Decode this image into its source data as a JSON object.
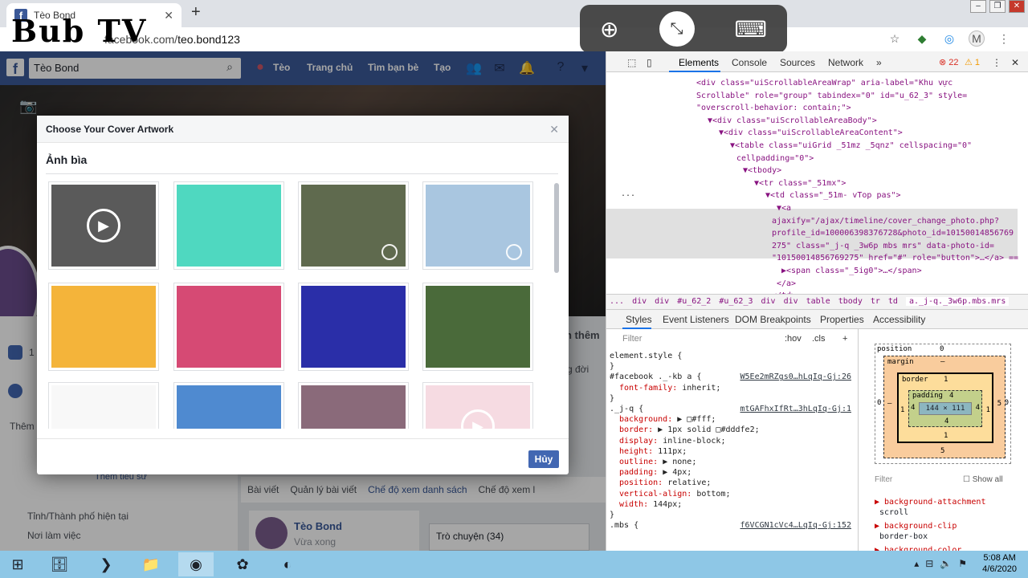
{
  "browser": {
    "tab_title": "Tèo Bond",
    "url_prefix": "facebook.com/",
    "url_path": "teo.bond123",
    "watermark": "Bub TV",
    "profile_initial": "M"
  },
  "remote_toolbar": {
    "zoom_icon": "zoom-in-icon",
    "connection_icon": "remote-connection-icon",
    "keyboard_icon": "keyboard-icon"
  },
  "facebook": {
    "logo": "f",
    "search_value": "Tèo Bond",
    "nav": {
      "profile": "Tèo",
      "home": "Trang chủ",
      "find_friends": "Tìm bạn bè",
      "create": "Tạo"
    },
    "behind": {
      "add_friend_partial": "n thêm",
      "link_partial": "g đời",
      "left_add": "Thêm",
      "left_add_partial": "Thêm tiểu sử",
      "city": "Tỉnh/Thành phố hiện tại",
      "workplace": "Nơi làm việc",
      "left_count": "1",
      "notif_badge": "1"
    },
    "timeline_tabs": {
      "posts": "Bài viết",
      "manage": "Quản lý bài viết",
      "list_view": "Chế độ xem danh sách",
      "grid_view": "Chế độ xem l"
    },
    "post": {
      "author": "Tèo Bond",
      "time": "Vừa xong"
    },
    "chat": "Trò chuyện (34)"
  },
  "dialog": {
    "title": "Choose Your Cover Artwork",
    "section": "Ảnh bìa",
    "cancel": "Hủy",
    "close_icon": "close-icon",
    "thumbnails": [
      {
        "name": "thumb-rocks-video",
        "bg": "#5a5a5a",
        "has_play": true,
        "has_target": false
      },
      {
        "name": "thumb-teal-pattern",
        "bg": "#4fd8c0",
        "has_play": false,
        "has_target": false
      },
      {
        "name": "thumb-waterfall-cliff",
        "bg": "#5f6a4e",
        "has_play": false,
        "has_target": true
      },
      {
        "name": "thumb-sky-clouds",
        "bg": "#a9c6e0",
        "has_play": false,
        "has_target": true
      },
      {
        "name": "thumb-yellow-pattern",
        "bg": "#f4b43a",
        "has_play": false,
        "has_target": false
      },
      {
        "name": "thumb-paint-strokes",
        "bg": "#d64a74",
        "has_play": false,
        "has_target": false
      },
      {
        "name": "thumb-blue-kaleidoscope",
        "bg": "#2a2ea8",
        "has_play": false,
        "has_target": false
      },
      {
        "name": "thumb-forest-waterfall",
        "bg": "#4a6a3a",
        "has_play": false,
        "has_target": false
      },
      {
        "name": "thumb-lines",
        "bg": "#f8f8f8",
        "has_play": false,
        "has_target": false
      },
      {
        "name": "thumb-blue-sky",
        "bg": "#4f8ad0",
        "has_play": false,
        "has_target": false
      },
      {
        "name": "thumb-sunset-mountain",
        "bg": "#8a6a7a",
        "has_play": false,
        "has_target": false
      },
      {
        "name": "thumb-hearts-video",
        "bg": "#f6dbe2",
        "has_play": true,
        "has_target": false
      }
    ]
  },
  "devtools": {
    "tabs": [
      "Elements",
      "Console",
      "Sources",
      "Network",
      "»"
    ],
    "errors": "22",
    "warnings": "1",
    "dom_lines": [
      {
        "text": "<div class=\"uiScrollableAreaWrap\" aria-label=\"Khu vực",
        "indent": 112
      },
      {
        "text": "Scrollable\" role=\"group\" tabindex=\"0\" id=\"u_62_3\" style=",
        "indent": 112
      },
      {
        "text": "\"overscroll-behavior: contain;\">",
        "indent": 112
      },
      {
        "text": "▼<div class=\"uiScrollableAreaBody\">",
        "indent": 126
      },
      {
        "text": "▼<div class=\"uiScrollableAreaContent\">",
        "indent": 140
      },
      {
        "text": "▼<table class=\"uiGrid _51mz _5qnz\" cellspacing=\"0\"",
        "indent": 154
      },
      {
        "text": "cellpadding=\"0\">",
        "indent": 162
      },
      {
        "text": "▼<tbody>",
        "indent": 170
      },
      {
        "text": "▼<tr class=\"_51mx\">",
        "indent": 184
      },
      {
        "text": "▼<td class=\"_51m- vTop pas\">",
        "indent": 198
      },
      {
        "text": "▼<a",
        "indent": 212
      },
      {
        "text": "ajaxify=\"/ajax/timeline/cover_change_photo.php?",
        "indent": 206
      },
      {
        "text": "profile_id=100006398376728&photo_id=10150014856769",
        "indent": 206
      },
      {
        "text": "275\" class=\"_j-q _3w6p mbs mrs\" data-photo-id=",
        "indent": 206
      },
      {
        "text": "\"10150014856769275\" href=\"#\" role=\"button\">…</a> ==",
        "indent": 206
      },
      {
        "text": "▶<span class=\"_5ig0\">…</span>",
        "indent": 218
      },
      {
        "text": "</a>",
        "indent": 212
      },
      {
        "text": "</td>",
        "indent": 206
      },
      {
        "text": "<td class=\"_51m- vTop pas\">",
        "indent": 198
      }
    ],
    "breadcrumbs": [
      "...",
      "div",
      "div",
      "#u_62_2",
      "#u_62_3",
      "div",
      "div",
      "table",
      "tbody",
      "tr",
      "td",
      "a._j-q._3w6p.mbs.mrs"
    ],
    "subtabs": [
      "Styles",
      "Event Listeners",
      "DOM Breakpoints",
      "Properties",
      "Accessibility"
    ],
    "filter_placeholder": "Filter",
    "hov": ":hov",
    "cls": ".cls",
    "styles": [
      {
        "text": "element.style {",
        "src": "",
        "kind": "sel"
      },
      {
        "text": "}",
        "src": "",
        "kind": "sel"
      },
      {
        "text": "#facebook ._-kb a {",
        "src": "W5Ee2mRZgs0…hLqIq-Gj:26",
        "kind": "sel"
      },
      {
        "text": "font-family: inherit;",
        "src": "",
        "kind": "prop"
      },
      {
        "text": "}",
        "src": "",
        "kind": "sel"
      },
      {
        "text": "._j-q {",
        "src": "mtGAFhxIfRt…3hLqIq-Gj:1",
        "kind": "sel"
      },
      {
        "text": "background: ▶ □#fff;",
        "src": "",
        "kind": "prop"
      },
      {
        "text": "border: ▶ 1px solid □#dddfe2;",
        "src": "",
        "kind": "prop"
      },
      {
        "text": "display: inline-block;",
        "src": "",
        "kind": "prop"
      },
      {
        "text": "height: 111px;",
        "src": "",
        "kind": "prop"
      },
      {
        "text": "outline: ▶ none;",
        "src": "",
        "kind": "prop"
      },
      {
        "text": "padding: ▶ 4px;",
        "src": "",
        "kind": "prop"
      },
      {
        "text": "position: relative;",
        "src": "",
        "kind": "prop"
      },
      {
        "text": "vertical-align: bottom;",
        "src": "",
        "kind": "prop"
      },
      {
        "text": "width: 144px;",
        "src": "",
        "kind": "prop"
      },
      {
        "text": "}",
        "src": "",
        "kind": "sel"
      },
      {
        "text": ".mbs {",
        "src": "f6VCGN1cVc4…LqIq-Gj:152",
        "kind": "sel"
      }
    ],
    "box_model": {
      "position_label": "position",
      "position_top": "0",
      "margin_label": "margin",
      "margin_top": "–",
      "margin_bottom": "5",
      "border_label": "border",
      "border_top": "1",
      "border_bottom": "1",
      "padding_label": "padding",
      "padding_value": "4",
      "padding_bottom": "4",
      "content": "144 × 111",
      "side_left_outer": "0",
      "side_left_margin": "–",
      "side_left_border": "1",
      "side_left_padding": "4",
      "side_right_padding": "4",
      "side_right_border": "1",
      "side_right_margin": "5",
      "side_right_outer": "0",
      "position_bottom": "0"
    },
    "computed_filter": "Filter",
    "show_all": "Show all",
    "computed": [
      {
        "prop": "background-attachment",
        "val": "scroll"
      },
      {
        "prop": "background-clip",
        "val": "border-box"
      },
      {
        "prop": "background-color",
        "val": ""
      }
    ]
  },
  "taskbar": {
    "time": "5:08 AM",
    "date": "4/6/2020"
  }
}
